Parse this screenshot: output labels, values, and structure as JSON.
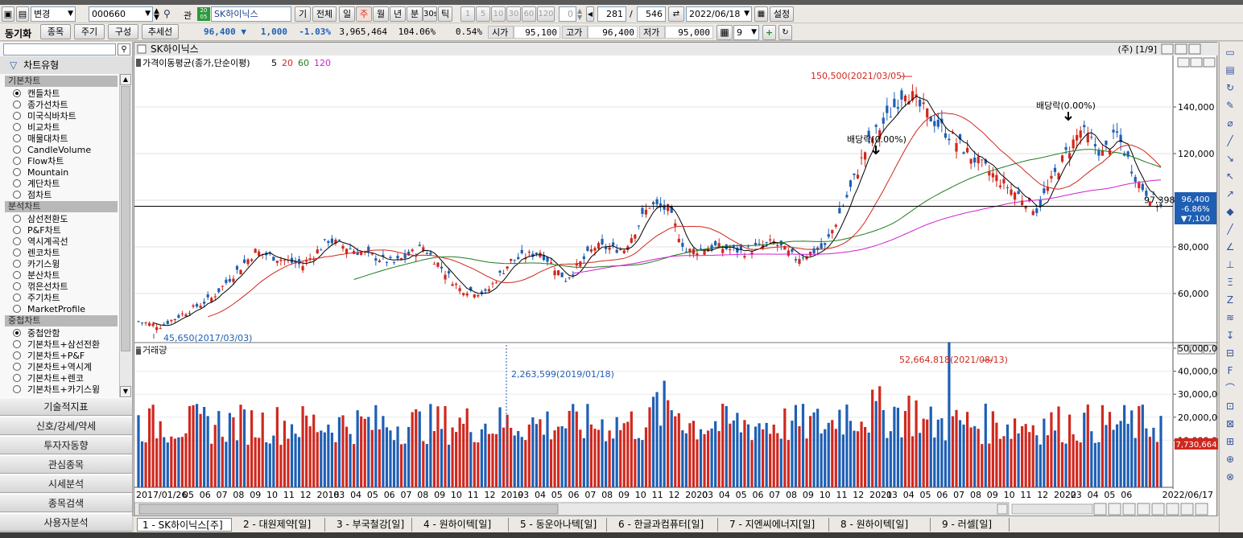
{
  "toolbar": {
    "mode_label": "변경",
    "code": "000660",
    "link_label": "관",
    "stock_name": "SK하이닉스",
    "btn_gi": "기",
    "btn_all": "전체",
    "periods": [
      "일",
      "주",
      "월",
      "년",
      "분",
      "30s",
      "틱"
    ],
    "minute_options": [
      "1",
      "5",
      "10",
      "30",
      "60",
      "120"
    ],
    "spin_value": "0",
    "count_view": "281",
    "count_total": "546",
    "date": "2022/06/18",
    "settings_label": "설정"
  },
  "quote": {
    "sync_label": "동기화",
    "btn_stock": "종목",
    "btn_period": "주기",
    "btn_compose": "구성",
    "btn_trend": "추세선",
    "price": "96,400",
    "change": "1,000",
    "change_pct": "-1.03%",
    "volume": "3,965,464",
    "vol_ratio": "104.06%",
    "turnover": "0.54%",
    "open_label": "시가",
    "open": "95,100",
    "high_label": "고가",
    "high": "96,400",
    "low_label": "저가",
    "low": "95,000",
    "grid_value": "9"
  },
  "sidebar": {
    "header": "차트유형",
    "sections": [
      {
        "title": "기본차트",
        "items": [
          "캔들차트",
          "종가선차트",
          "미국식바차트",
          "비교차트",
          "매물대차트",
          "CandleVolume",
          "Flow차트",
          "Mountain",
          "계단차트",
          "점차트"
        ],
        "selected": 0
      },
      {
        "title": "분석차트",
        "items": [
          "삼선전환도",
          "P&F차트",
          "역시계곡선",
          "렌코차트",
          "카기스윙",
          "분산차트",
          "꺾은선차트",
          "주기차트",
          "MarketProfile"
        ],
        "selected": -1
      },
      {
        "title": "중첩차트",
        "items": [
          "중첩안함",
          "기본차트+삼선전환",
          "기본차트+P&F",
          "기본차트+역시계",
          "기본차트+렌코",
          "기본차트+카기스윙"
        ],
        "selected": 0
      }
    ],
    "menu": [
      "기술적지표",
      "신호/강세/약세",
      "투자자동향",
      "관심종목",
      "시세분석",
      "종목검색",
      "사용자분석"
    ]
  },
  "chart": {
    "title": "SK하이닉스",
    "period_info": "(주) [1/9]",
    "price_pane_label": "가격이동평균(종가,단순이평)",
    "ma_labels": [
      {
        "text": "5",
        "color": "#000000"
      },
      {
        "text": "20",
        "color": "#d0281e"
      },
      {
        "text": "60",
        "color": "#207a20"
      },
      {
        "text": "120",
        "color": "#d020d0"
      }
    ],
    "volume_pane_label": "거래량",
    "annotations": {
      "high": "150,500(2021/03/05)",
      "low": "45,650(2017/03/03)",
      "div1": "배당락(0.00%)",
      "div2": "배당락(0.00%)",
      "vol_max": "52,664,818(2021/08/13)",
      "vol_cursor": "2,263,599(2019/01/18)"
    },
    "price_axis": [
      "140,000",
      "120,000",
      "100,000",
      "80,000",
      "60,000"
    ],
    "cursor_price": "97,398",
    "current_box": [
      "96,400",
      "-6.86%",
      "▼7,100"
    ],
    "volume_axis": [
      "50,000,000",
      "40,000,000",
      "30,000,000",
      "20,000,000",
      "10,000,000"
    ],
    "volume_box": "7,730,664",
    "x_labels": [
      "2017/01/26",
      "05",
      "06",
      "07",
      "08",
      "09",
      "10",
      "11",
      "12",
      "2018",
      "03",
      "04",
      "05",
      "06",
      "07",
      "08",
      "09",
      "10",
      "11",
      "12",
      "2019",
      "03",
      "04",
      "05",
      "06",
      "07",
      "08",
      "09",
      "10",
      "11",
      "12",
      "2020",
      "03",
      "04",
      "05",
      "06",
      "07",
      "08",
      "09",
      "10",
      "11",
      "12",
      "2021",
      "03",
      "04",
      "05",
      "06",
      "07",
      "08",
      "09",
      "10",
      "11",
      "12",
      "2022",
      "03",
      "04",
      "05",
      "06",
      "2022/06/17"
    ],
    "pane_buttons": [
      "L",
      "□",
      "X"
    ],
    "colors": {
      "up": "#d0281e",
      "down": "#1e5fb4",
      "ma5": "#000000",
      "ma20": "#d0281e",
      "ma60": "#207a20",
      "ma120": "#d020d0"
    }
  },
  "bottom_tabs": [
    "1 - SK하이닉스[주]",
    "2 - 대원제약[일]",
    "3 - 부국철강[일]",
    "4 - 원하이텍[일]",
    "5 - 동운아나텍[일]",
    "6 - 한글과컴퓨터[일]",
    "7 - 지엔씨에너지[일]",
    "8 - 원하이텍[일]",
    "9 - 러셀[일]"
  ]
}
